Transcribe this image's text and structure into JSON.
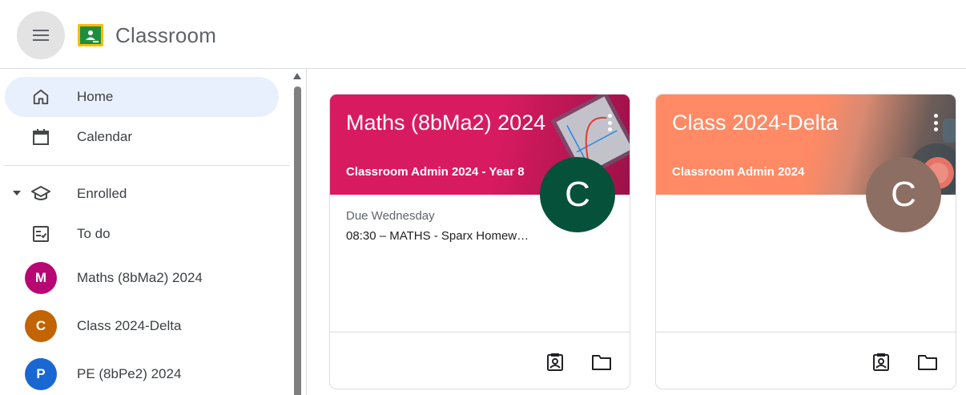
{
  "header": {
    "app_title": "Classroom"
  },
  "sidebar": {
    "items": [
      {
        "label": "Home",
        "icon": "home-icon",
        "active": true
      },
      {
        "label": "Calendar",
        "icon": "calendar-icon"
      }
    ],
    "enrolled": {
      "label": "Enrolled",
      "icon": "graduation-cap-icon",
      "items": [
        {
          "label": "To do",
          "icon": "todo-icon"
        },
        {
          "label": "Maths (8bMa2) 2024",
          "initial": "M",
          "color": "#b80672"
        },
        {
          "label": "Class 2024-Delta",
          "initial": "C",
          "color": "#c26401"
        },
        {
          "label": "PE (8bPe2) 2024",
          "initial": "P",
          "color": "#1967d2"
        }
      ]
    }
  },
  "cards": [
    {
      "title": "Maths (8bMa2) 2024",
      "section": "Classroom Admin 2024 - Year 8",
      "teacher_initial": "C",
      "avatar_color": "#06513a",
      "banner_color": "#d81b60",
      "due_label": "Due Wednesday",
      "due_item": "08:30 – MATHS - Sparx Homew…"
    },
    {
      "title": "Class 2024-Delta",
      "section": "Classroom Admin 2024",
      "teacher_initial": "C",
      "avatar_color": "#8d6e63",
      "banner_color": "#ff8a65",
      "due_label": "",
      "due_item": ""
    }
  ]
}
